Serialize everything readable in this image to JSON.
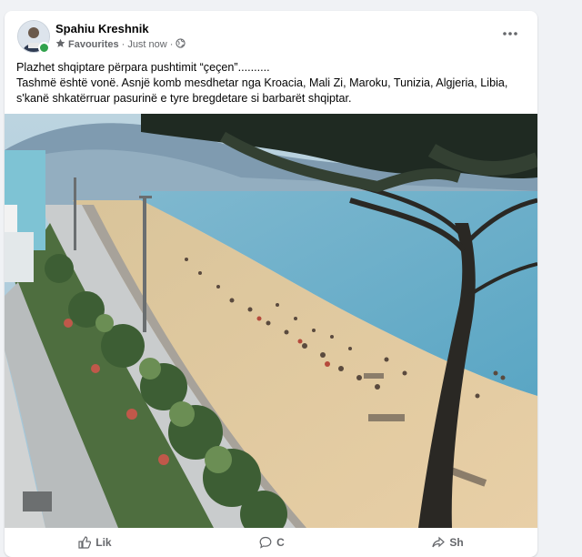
{
  "post": {
    "author": "Spahiu Kreshnik",
    "audience": "Favourites",
    "separator": "·",
    "time": "Just now",
    "separator2": "·",
    "text_line1": "Plazhet shqiptare përpara pushtimit “çeçen”..........",
    "text_line2": "Tashmë është vonë. Asnjë komb mesdhetar nga Kroacia, Mali Zi, Maroku, Tunizia, Algjeria, Libia,",
    "text_line3": "s'kanë shkatërruar pasurinë e tyre bregdetare si barbarët shqiptar."
  },
  "actions": {
    "like": "Lik",
    "comment": "C",
    "share": "Sh"
  },
  "icons": {
    "favourites": "star-icon",
    "privacy": "globe-icon",
    "more": "more-horizontal-icon",
    "like": "thumbs-up-icon",
    "comment": "comment-icon",
    "share": "share-icon"
  },
  "colors": {
    "text": "#050505",
    "secondary": "#65676b",
    "online": "#31a24c",
    "background": "#f0f2f5"
  }
}
